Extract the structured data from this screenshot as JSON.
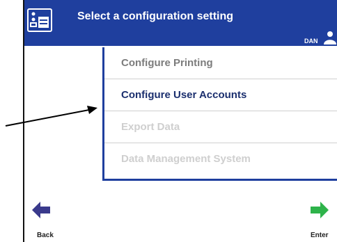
{
  "header": {
    "title": "Select a configuration setting",
    "user": "DAN",
    "background": "#1f3f9e",
    "app_icon": "settings-list-icon",
    "user_icon": "user-icon"
  },
  "menu": {
    "items": [
      {
        "label": "Configure Printing",
        "state": "normal"
      },
      {
        "label": "Configure User Accounts",
        "state": "active"
      },
      {
        "label": "Export Data",
        "state": "disabled"
      },
      {
        "label": "Data Management System",
        "state": "disabled"
      }
    ]
  },
  "footer": {
    "back": {
      "label": "Back",
      "icon": "back-arrow-icon",
      "color": "#3a3a8c"
    },
    "enter": {
      "label": "Enter",
      "icon": "enter-arrow-icon",
      "color": "#2eb34a"
    }
  },
  "callout": {
    "icon": "callout-arrow-icon",
    "color": "#000000"
  }
}
